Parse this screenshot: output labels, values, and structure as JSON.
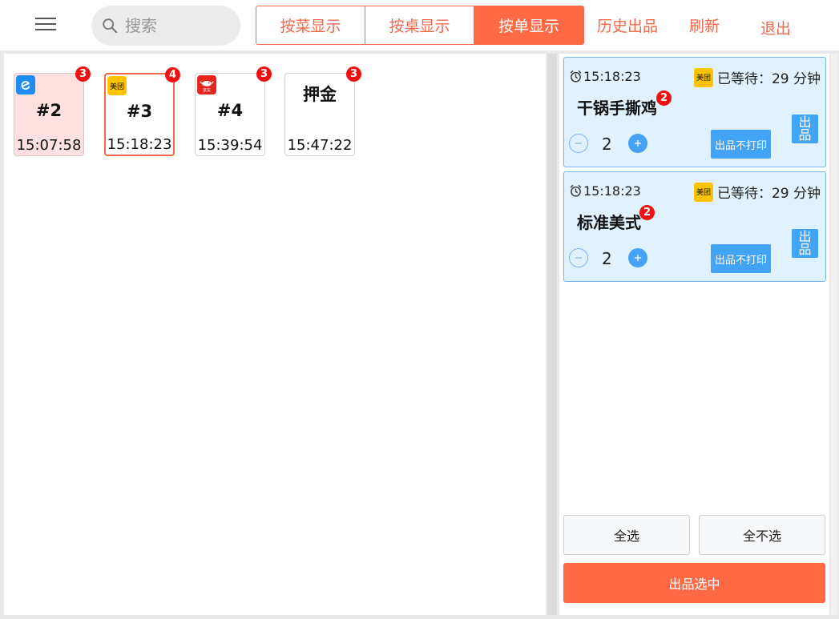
{
  "header": {
    "search_placeholder": "搜索",
    "view_tabs": [
      {
        "label": "按菜显示",
        "active": false
      },
      {
        "label": "按桌显示",
        "active": false
      },
      {
        "label": "按单显示",
        "active": true
      }
    ],
    "history_label": "历史出品",
    "refresh_label": "刷新",
    "logout_label": "退出"
  },
  "orders": [
    {
      "label": "#2",
      "time": "15:07:58",
      "count": "3",
      "platform": "eleme",
      "platform_text": "",
      "highlight": "pink"
    },
    {
      "label": "#3",
      "time": "15:18:23",
      "count": "4",
      "platform": "meituan",
      "platform_text": "美团",
      "highlight": "selected"
    },
    {
      "label": "#4",
      "time": "15:39:54",
      "count": "3",
      "platform": "jd",
      "platform_text": "京东",
      "highlight": "none"
    },
    {
      "label": "押金",
      "time": "15:47:22",
      "count": "3",
      "platform": "none",
      "platform_text": "",
      "highlight": "none"
    }
  ],
  "dishes": [
    {
      "time": "15:18:23",
      "platform_text": "美团",
      "wait_text": "已等待：29 分钟",
      "name": "干锅手撕鸡",
      "count": "2",
      "qty": "2",
      "noprint_label": "出品不打印",
      "serve_label_1": "出",
      "serve_label_2": "品"
    },
    {
      "time": "15:18:23",
      "platform_text": "美团",
      "wait_text": "已等待：29 分钟",
      "name": "标准美式",
      "count": "2",
      "qty": "2",
      "noprint_label": "出品不打印",
      "serve_label_1": "出",
      "serve_label_2": "品"
    }
  ],
  "actions": {
    "select_all": "全选",
    "select_none": "全不选",
    "serve_selected": "出品选中"
  },
  "colors": {
    "accent": "#ff6a45",
    "card_blue": "#e0f1ff",
    "button_blue": "#42a4f4",
    "badge_red": "#ee1111"
  }
}
